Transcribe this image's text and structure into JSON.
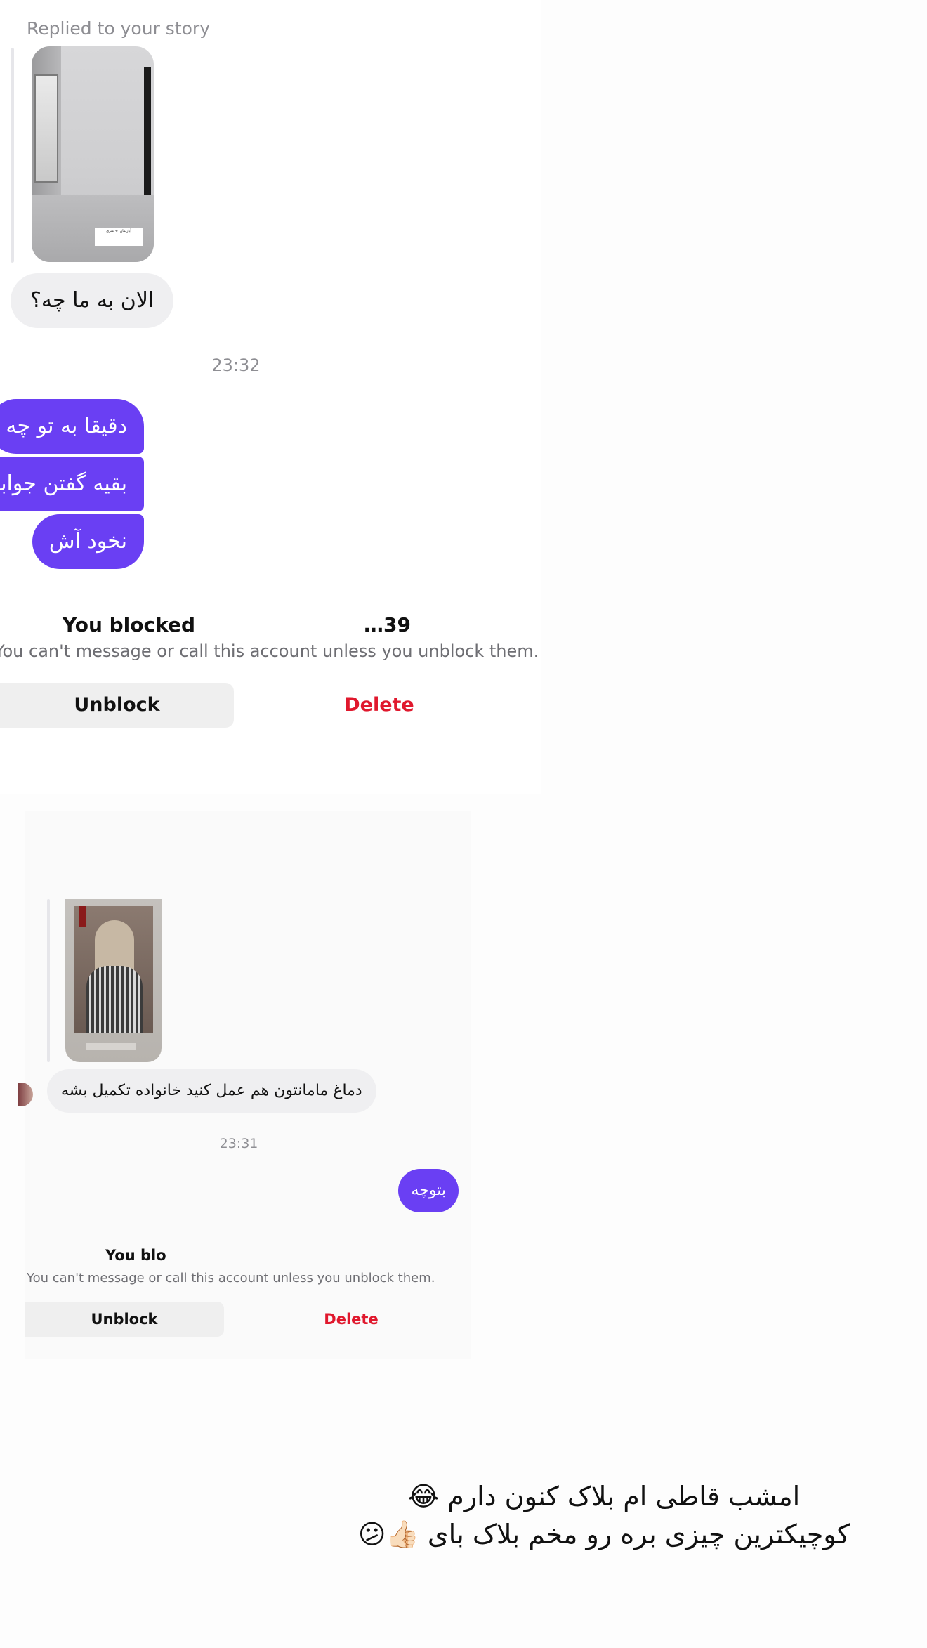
{
  "screenshot_1": {
    "replied_label": "Replied to your story",
    "story_caption": "آپارتمان ۹۰ متری",
    "incoming_message": "الان به ما چه؟",
    "timestamp": "23:32",
    "outgoing_messages": [
      "دقیقا به تو چه",
      "بقیه گفتن جوابشون دادم",
      "نخود آش"
    ],
    "blocked_title_start": "You blocked",
    "blocked_title_end": "…39",
    "blocked_subtitle": "You can't message or call this account unless you unblock them.",
    "unblock_label": "Unblock",
    "delete_label": "Delete"
  },
  "screenshot_2": {
    "incoming_message": "دماغ مامانتون هم عمل کنید خانواده تکمیل بشه",
    "timestamp": "23:31",
    "outgoing_message": "بتوچه",
    "blocked_title_start": "You blo",
    "blocked_subtitle": "You can't message or call this account unless you unblock them.",
    "unblock_label": "Unblock",
    "delete_label": "Delete"
  },
  "overlay_caption": {
    "line_1": "امشب قاطی ام بلاک کنون دارم 😂",
    "line_2": "کوچیکترین چیزی بره رو مخم بلاک بای 👍🏻😕"
  },
  "colors": {
    "outgoing_bubble": "#6a3ff3",
    "incoming_bubble": "#efeff1",
    "delete_red": "#e0182d"
  }
}
